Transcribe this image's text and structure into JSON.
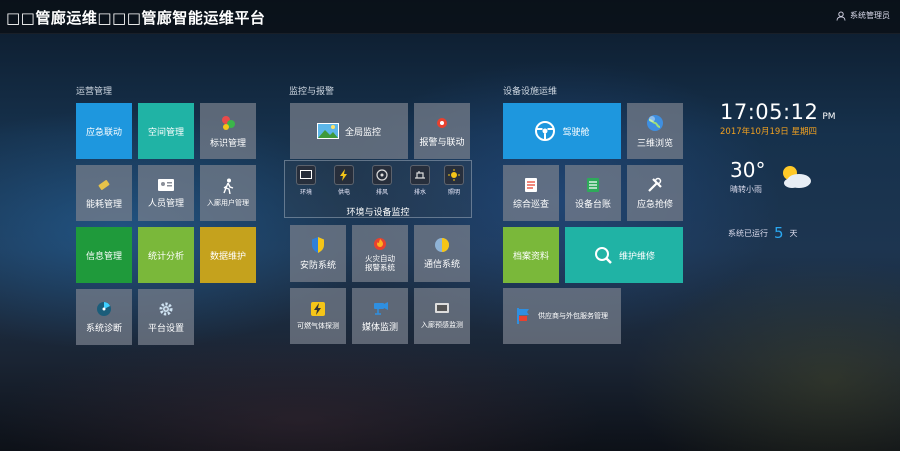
{
  "header": {
    "title": "□□管廊运维□□□管廊智能运维平台",
    "user_label": "系统管理员"
  },
  "sections": {
    "ops": "运营管理",
    "monitor": "监控与报警",
    "facility": "设备设施运维"
  },
  "ops_tiles": {
    "emergency": "应急联动",
    "space": "空间管理",
    "marker": "标识管理",
    "energy": "能耗管理",
    "personnel": "人员管理",
    "entry": "入廊用户管理",
    "info": "信息管理",
    "stats": "统计分析",
    "data": "数据维护",
    "diag": "系统诊断",
    "platform": "平台设置"
  },
  "monitor_tiles": {
    "full": "全局监控",
    "alarm": "报警与联动",
    "env_title": "环境与设备监控",
    "env_items": [
      "环境",
      "供电",
      "排风",
      "排水",
      "照明"
    ],
    "security": "安防系统",
    "fire": "火灾自动\n报警系统",
    "comm": "通信系统",
    "gas": "可燃气体探测",
    "media": "媒体监测",
    "intrusion": "入廊预感监测"
  },
  "facility_tiles": {
    "cockpit": "驾驶舱",
    "3d": "三维浏览",
    "inspect": "综合巡查",
    "ledger": "设备台账",
    "repair": "应急抢修",
    "archive": "档案资料",
    "maintain": "维护维修",
    "supplier": "供应商与外包服务管理"
  },
  "clock": {
    "time": "17:05:12",
    "ampm": "PM",
    "date": "2017年10月19日 星期四"
  },
  "weather": {
    "temp": "30°",
    "desc": "晴转小雨"
  },
  "uptime": {
    "label": "系统已运行",
    "days": "5",
    "unit": "天"
  },
  "colors": {
    "blue": "#1e97de",
    "teal": "#20b3a5",
    "green": "#1f9a3b",
    "light_green": "#7ab83a",
    "gold": "#c5a21d",
    "date_orange": "#f0a020"
  }
}
